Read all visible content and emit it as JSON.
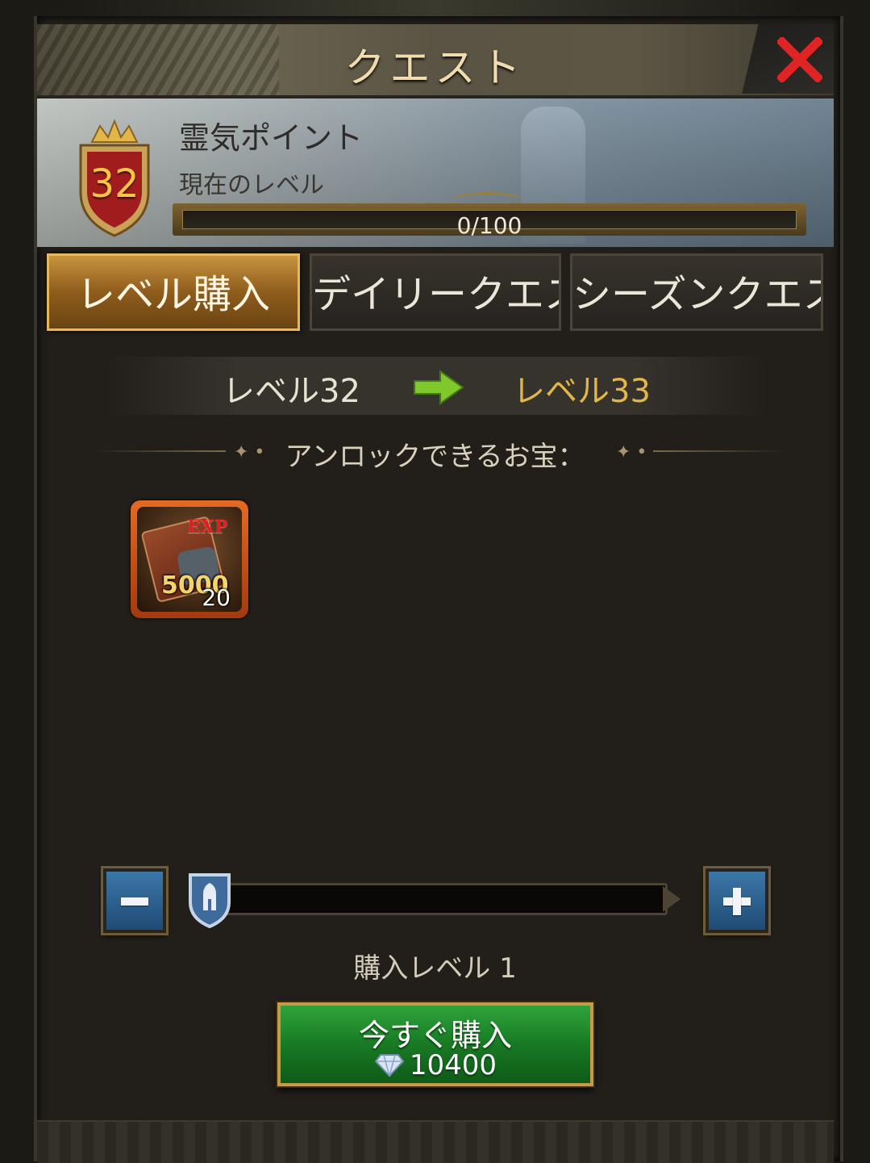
{
  "dialog": {
    "title": "クエスト"
  },
  "header": {
    "level_badge": "32",
    "points_title": "霊気ポイント",
    "current_level_label": "現在のレベル",
    "progress_text": "0/100",
    "progress_fraction": 0
  },
  "tabs": [
    {
      "label": "レベル購入",
      "active": true
    },
    {
      "label": "デイリークエスト",
      "active": false
    },
    {
      "label": "シーズンクエスト",
      "active": false
    }
  ],
  "level_change": {
    "from": "レベル32",
    "to": "レベル33"
  },
  "treasure": {
    "heading": "アンロックできるお宝：",
    "items": [
      {
        "tag": "EXP",
        "amount": "5000",
        "count": "20"
      }
    ]
  },
  "slider": {
    "value": 1,
    "label": "購入レベル 1"
  },
  "buy_button": {
    "label": "今すぐ購入",
    "price": "10400"
  },
  "colors": {
    "accent_gold": "#e3b649",
    "tab_active": "#c79440",
    "buy_green": "#187a24",
    "close_red": "#e02424"
  },
  "icons": [
    "close-icon",
    "crown-shield-icon",
    "green-arrow-icon",
    "exp-book-icon",
    "minus-icon",
    "plus-icon",
    "knight-thumb-icon",
    "diamond-icon"
  ]
}
